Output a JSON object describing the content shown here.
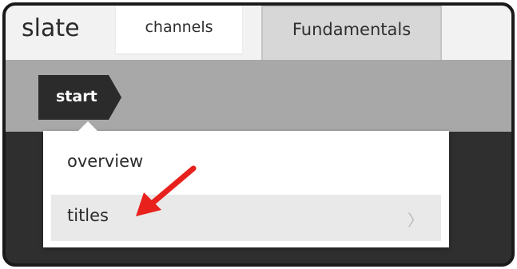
{
  "app": {
    "title": "slate"
  },
  "tabs": [
    {
      "label": "channels",
      "active": false
    },
    {
      "label": "Fundamentals",
      "active": true
    }
  ],
  "breadcrumb": {
    "current": "start"
  },
  "menu": {
    "items": [
      {
        "label": "overview",
        "highlighted": false,
        "has_submenu": false
      },
      {
        "label": "titles",
        "highlighted": true,
        "has_submenu": true
      }
    ],
    "submenu_glyph": "〉"
  },
  "annotation": {
    "icon": "red-arrow-icon",
    "color": "#e8211c",
    "points_to": "titles"
  },
  "colors": {
    "topbar": "#f2f2f2",
    "breadcrumb_bar": "#a8a8a8",
    "content_bg": "#2f2f2f",
    "breadcrumb_chip": "#2b2b2b",
    "highlight_row": "#e9e9e9"
  }
}
